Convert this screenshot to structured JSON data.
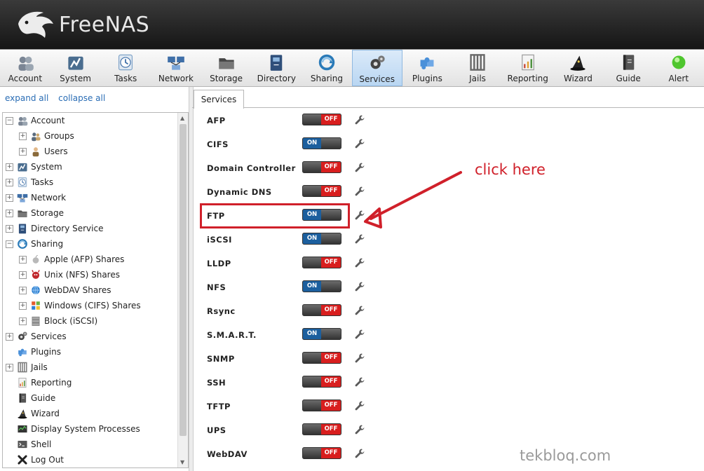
{
  "app": {
    "logo_text": "FreeNAS"
  },
  "toolbar": {
    "items": [
      {
        "label": "Account",
        "icon": "users-icon",
        "active": false
      },
      {
        "label": "System",
        "icon": "system-gauge-icon",
        "active": false
      },
      {
        "label": "Tasks",
        "icon": "clock-icon",
        "active": false
      },
      {
        "label": "Network",
        "icon": "network-icon",
        "active": false
      },
      {
        "label": "Storage",
        "icon": "folder-icon",
        "active": false
      },
      {
        "label": "Directory",
        "icon": "directory-book-icon",
        "active": false
      },
      {
        "label": "Sharing",
        "icon": "sharing-globe-icon",
        "active": false
      },
      {
        "label": "Services",
        "icon": "gears-icon",
        "active": true
      },
      {
        "label": "Plugins",
        "icon": "puzzle-icon",
        "active": false
      },
      {
        "label": "Jails",
        "icon": "jail-bars-icon",
        "active": false
      },
      {
        "label": "Reporting",
        "icon": "report-icon",
        "active": false
      },
      {
        "label": "Wizard",
        "icon": "wizard-hat-icon",
        "active": false
      },
      {
        "label": "Guide",
        "icon": "guide-book-icon",
        "active": false
      },
      {
        "label": "Alert",
        "icon": "alert-light-icon",
        "active": false
      }
    ]
  },
  "left": {
    "expand_all": "expand all",
    "collapse_all": "collapse all",
    "tree": [
      {
        "label": "Account",
        "indent": 0,
        "expander": "−",
        "icon": "users-icon",
        "color": "#7a8594"
      },
      {
        "label": "Groups",
        "indent": 1,
        "expander": "+",
        "icon": "group-icon",
        "color": "#5a6b7d"
      },
      {
        "label": "Users",
        "indent": 1,
        "expander": "+",
        "icon": "user-icon",
        "color": "#8a6a3a"
      },
      {
        "label": "System",
        "indent": 0,
        "expander": "+",
        "icon": "system-gauge-icon",
        "color": "#4a6d8f"
      },
      {
        "label": "Tasks",
        "indent": 0,
        "expander": "+",
        "icon": "clock-icon",
        "color": "#7fa3c8"
      },
      {
        "label": "Network",
        "indent": 0,
        "expander": "+",
        "icon": "network-icon",
        "color": "#3f6fa8"
      },
      {
        "label": "Storage",
        "indent": 0,
        "expander": "+",
        "icon": "folder-icon",
        "color": "#555555"
      },
      {
        "label": "Directory Service",
        "indent": 0,
        "expander": "+",
        "icon": "directory-book-icon",
        "color": "#2f4f7a"
      },
      {
        "label": "Sharing",
        "indent": 0,
        "expander": "−",
        "icon": "sharing-globe-icon",
        "color": "#2a7ab8"
      },
      {
        "label": "Apple (AFP) Shares",
        "indent": 1,
        "expander": "+",
        "icon": "apple-icon",
        "color": "#b9b9b9"
      },
      {
        "label": "Unix (NFS) Shares",
        "indent": 1,
        "expander": "+",
        "icon": "bsd-daemon-icon",
        "color": "#c0282d"
      },
      {
        "label": "WebDAV Shares",
        "indent": 1,
        "expander": "+",
        "icon": "globe-icon",
        "color": "#2c7fd0"
      },
      {
        "label": "Windows (CIFS) Shares",
        "indent": 1,
        "expander": "+",
        "icon": "windows-icon",
        "color": "#e8a13a"
      },
      {
        "label": "Block (iSCSI)",
        "indent": 1,
        "expander": "+",
        "icon": "disk-stack-icon",
        "color": "#a9a9a9"
      },
      {
        "label": "Services",
        "indent": 0,
        "expander": "+",
        "icon": "gears-icon",
        "color": "#444444"
      },
      {
        "label": "Plugins",
        "indent": 0,
        "expander": "",
        "icon": "puzzle-icon",
        "color": "#4a90d9"
      },
      {
        "label": "Jails",
        "indent": 0,
        "expander": "+",
        "icon": "jail-bars-icon",
        "color": "#777777"
      },
      {
        "label": "Reporting",
        "indent": 0,
        "expander": "",
        "icon": "report-icon",
        "color": "#c94b3b"
      },
      {
        "label": "Guide",
        "indent": 0,
        "expander": "",
        "icon": "guide-book-icon",
        "color": "#555555"
      },
      {
        "label": "Wizard",
        "indent": 0,
        "expander": "",
        "icon": "wizard-hat-icon",
        "color": "#333333"
      },
      {
        "label": "Display System Processes",
        "indent": 0,
        "expander": "",
        "icon": "process-monitor-icon",
        "color": "#333333"
      },
      {
        "label": "Shell",
        "indent": 0,
        "expander": "",
        "icon": "terminal-icon",
        "color": "#555555"
      },
      {
        "label": "Log Out",
        "indent": 0,
        "expander": "",
        "icon": "logout-x-icon",
        "color": "#222222"
      }
    ]
  },
  "main": {
    "tab_label": "Services",
    "services": [
      {
        "name": "AFP",
        "state": "OFF"
      },
      {
        "name": "CIFS",
        "state": "ON"
      },
      {
        "name": "Domain Controller",
        "state": "OFF"
      },
      {
        "name": "Dynamic DNS",
        "state": "OFF"
      },
      {
        "name": "FTP",
        "state": "ON"
      },
      {
        "name": "iSCSI",
        "state": "ON"
      },
      {
        "name": "LLDP",
        "state": "OFF"
      },
      {
        "name": "NFS",
        "state": "ON"
      },
      {
        "name": "Rsync",
        "state": "OFF"
      },
      {
        "name": "S.M.A.R.T.",
        "state": "ON"
      },
      {
        "name": "SNMP",
        "state": "OFF"
      },
      {
        "name": "SSH",
        "state": "OFF"
      },
      {
        "name": "TFTP",
        "state": "OFF"
      },
      {
        "name": "UPS",
        "state": "OFF"
      },
      {
        "name": "WebDAV",
        "state": "OFF"
      }
    ]
  },
  "annotation": {
    "text": "click here",
    "color": "#d0202a"
  },
  "watermark": "tekbloq.com"
}
